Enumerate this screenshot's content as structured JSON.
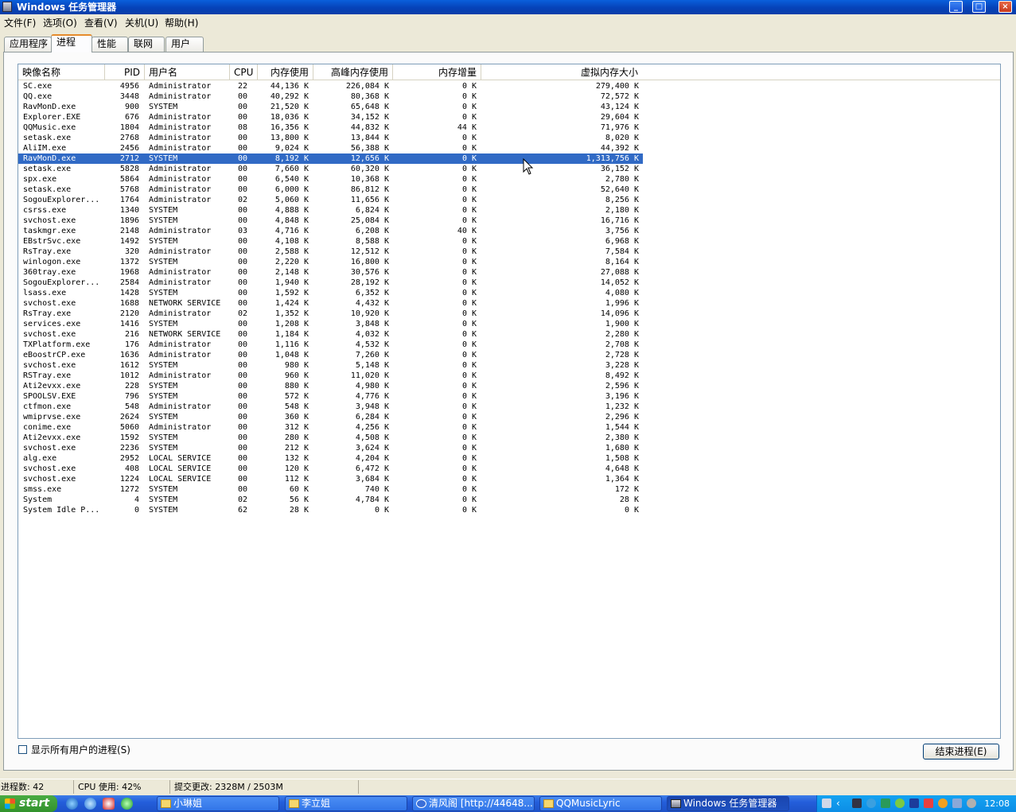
{
  "window": {
    "title": "Windows 任务管理器",
    "min": "_",
    "max": "□",
    "close": "×"
  },
  "menu": [
    "文件(F)",
    "选项(O)",
    "查看(V)",
    "关机(U)",
    "帮助(H)"
  ],
  "tabs": [
    {
      "label": "应用程序"
    },
    {
      "label": "进程"
    },
    {
      "label": "性能"
    },
    {
      "label": "联网"
    },
    {
      "label": "用户"
    }
  ],
  "columns": [
    "映像名称",
    "PID",
    "用户名",
    "CPU",
    "内存使用",
    "高峰内存使用",
    "内存增量",
    "虚拟内存大小"
  ],
  "selected_index": 7,
  "processes": [
    [
      "SC.exe",
      "4956",
      "Administrator",
      "22",
      "44,136 K",
      "226,084 K",
      "0 K",
      "279,400 K"
    ],
    [
      "QQ.exe",
      "3448",
      "Administrator",
      "00",
      "40,292 K",
      "80,368 K",
      "0 K",
      "72,572 K"
    ],
    [
      "RavMonD.exe",
      "900",
      "SYSTEM",
      "00",
      "21,520 K",
      "65,648 K",
      "0 K",
      "43,124 K"
    ],
    [
      "Explorer.EXE",
      "676",
      "Administrator",
      "00",
      "18,036 K",
      "34,152 K",
      "0 K",
      "29,604 K"
    ],
    [
      "QQMusic.exe",
      "1804",
      "Administrator",
      "08",
      "16,356 K",
      "44,832 K",
      "44 K",
      "71,976 K"
    ],
    [
      "setask.exe",
      "2768",
      "Administrator",
      "00",
      "13,800 K",
      "13,844 K",
      "0 K",
      "8,020 K"
    ],
    [
      "AliIM.exe",
      "2456",
      "Administrator",
      "00",
      "9,024 K",
      "56,388 K",
      "0 K",
      "44,392 K"
    ],
    [
      "RavMonD.exe",
      "2712",
      "SYSTEM",
      "00",
      "8,192 K",
      "12,656 K",
      "0 K",
      "1,313,756 K"
    ],
    [
      "setask.exe",
      "5828",
      "Administrator",
      "00",
      "7,660 K",
      "60,320 K",
      "0 K",
      "36,152 K"
    ],
    [
      "spx.exe",
      "5864",
      "Administrator",
      "00",
      "6,540 K",
      "10,368 K",
      "0 K",
      "2,780 K"
    ],
    [
      "setask.exe",
      "5768",
      "Administrator",
      "00",
      "6,000 K",
      "86,812 K",
      "0 K",
      "52,640 K"
    ],
    [
      "SogouExplorer...",
      "1764",
      "Administrator",
      "02",
      "5,060 K",
      "11,656 K",
      "0 K",
      "8,256 K"
    ],
    [
      "csrss.exe",
      "1340",
      "SYSTEM",
      "00",
      "4,888 K",
      "6,824 K",
      "0 K",
      "2,180 K"
    ],
    [
      "svchost.exe",
      "1896",
      "SYSTEM",
      "00",
      "4,848 K",
      "25,084 K",
      "0 K",
      "16,716 K"
    ],
    [
      "taskmgr.exe",
      "2148",
      "Administrator",
      "03",
      "4,716 K",
      "6,208 K",
      "40 K",
      "3,756 K"
    ],
    [
      "EBstrSvc.exe",
      "1492",
      "SYSTEM",
      "00",
      "4,108 K",
      "8,588 K",
      "0 K",
      "6,968 K"
    ],
    [
      "RsTray.exe",
      "320",
      "Administrator",
      "00",
      "2,588 K",
      "12,512 K",
      "0 K",
      "7,584 K"
    ],
    [
      "winlogon.exe",
      "1372",
      "SYSTEM",
      "00",
      "2,220 K",
      "16,800 K",
      "0 K",
      "8,164 K"
    ],
    [
      "360tray.exe",
      "1968",
      "Administrator",
      "00",
      "2,148 K",
      "30,576 K",
      "0 K",
      "27,088 K"
    ],
    [
      "SogouExplorer...",
      "2584",
      "Administrator",
      "00",
      "1,940 K",
      "28,192 K",
      "0 K",
      "14,052 K"
    ],
    [
      "lsass.exe",
      "1428",
      "SYSTEM",
      "00",
      "1,592 K",
      "6,352 K",
      "0 K",
      "4,080 K"
    ],
    [
      "svchost.exe",
      "1688",
      "NETWORK SERVICE",
      "00",
      "1,424 K",
      "4,432 K",
      "0 K",
      "1,996 K"
    ],
    [
      "RsTray.exe",
      "2120",
      "Administrator",
      "02",
      "1,352 K",
      "10,920 K",
      "0 K",
      "14,096 K"
    ],
    [
      "services.exe",
      "1416",
      "SYSTEM",
      "00",
      "1,208 K",
      "3,848 K",
      "0 K",
      "1,900 K"
    ],
    [
      "svchost.exe",
      "216",
      "NETWORK SERVICE",
      "00",
      "1,184 K",
      "4,032 K",
      "0 K",
      "2,280 K"
    ],
    [
      "TXPlatform.exe",
      "176",
      "Administrator",
      "00",
      "1,116 K",
      "4,532 K",
      "0 K",
      "2,708 K"
    ],
    [
      "eBoostrCP.exe",
      "1636",
      "Administrator",
      "00",
      "1,048 K",
      "7,260 K",
      "0 K",
      "2,728 K"
    ],
    [
      "svchost.exe",
      "1612",
      "SYSTEM",
      "00",
      "980 K",
      "5,148 K",
      "0 K",
      "3,228 K"
    ],
    [
      "RSTray.exe",
      "1012",
      "Administrator",
      "00",
      "960 K",
      "11,020 K",
      "0 K",
      "8,492 K"
    ],
    [
      "Ati2evxx.exe",
      "228",
      "SYSTEM",
      "00",
      "880 K",
      "4,980 K",
      "0 K",
      "2,596 K"
    ],
    [
      "SPOOLSV.EXE",
      "796",
      "SYSTEM",
      "00",
      "572 K",
      "4,776 K",
      "0 K",
      "3,196 K"
    ],
    [
      "ctfmon.exe",
      "548",
      "Administrator",
      "00",
      "548 K",
      "3,948 K",
      "0 K",
      "1,232 K"
    ],
    [
      "wmiprvse.exe",
      "2624",
      "SYSTEM",
      "00",
      "360 K",
      "6,284 K",
      "0 K",
      "2,296 K"
    ],
    [
      "conime.exe",
      "5060",
      "Administrator",
      "00",
      "312 K",
      "4,256 K",
      "0 K",
      "1,544 K"
    ],
    [
      "Ati2evxx.exe",
      "1592",
      "SYSTEM",
      "00",
      "280 K",
      "4,508 K",
      "0 K",
      "2,380 K"
    ],
    [
      "svchost.exe",
      "2236",
      "SYSTEM",
      "00",
      "212 K",
      "3,624 K",
      "0 K",
      "1,680 K"
    ],
    [
      "alg.exe",
      "2952",
      "LOCAL SERVICE",
      "00",
      "132 K",
      "4,204 K",
      "0 K",
      "1,508 K"
    ],
    [
      "svchost.exe",
      "408",
      "LOCAL SERVICE",
      "00",
      "120 K",
      "6,472 K",
      "0 K",
      "4,648 K"
    ],
    [
      "svchost.exe",
      "1224",
      "LOCAL SERVICE",
      "00",
      "112 K",
      "3,684 K",
      "0 K",
      "1,364 K"
    ],
    [
      "smss.exe",
      "1272",
      "SYSTEM",
      "00",
      "60 K",
      "740 K",
      "0 K",
      "172 K"
    ],
    [
      "System",
      "4",
      "SYSTEM",
      "02",
      "56 K",
      "4,784 K",
      "0 K",
      "28 K"
    ],
    [
      "System Idle P...",
      "0",
      "SYSTEM",
      "62",
      "28 K",
      "0 K",
      "0 K",
      "0 K"
    ]
  ],
  "show_all_label": "显示所有用户的进程(S)",
  "end_process_label": "结束进程(E)",
  "status": {
    "processes": "进程数: 42",
    "cpu": "CPU 使用: 42%",
    "commit": "提交更改: 2328M / 2503M"
  },
  "taskbar": {
    "start_label": "start",
    "buttons": [
      {
        "label": "小琳姐",
        "icon": "folder-icon"
      },
      {
        "label": "李立姐",
        "icon": "folder-icon"
      },
      {
        "label": "清风阁 [http://44648...",
        "icon": "sogou-icon"
      },
      {
        "label": "QQMusicLyric",
        "icon": "folder-icon"
      },
      {
        "label": "Windows 任务管理器",
        "icon": "taskmgr-icon",
        "active": true
      }
    ],
    "clock": "12:08"
  }
}
